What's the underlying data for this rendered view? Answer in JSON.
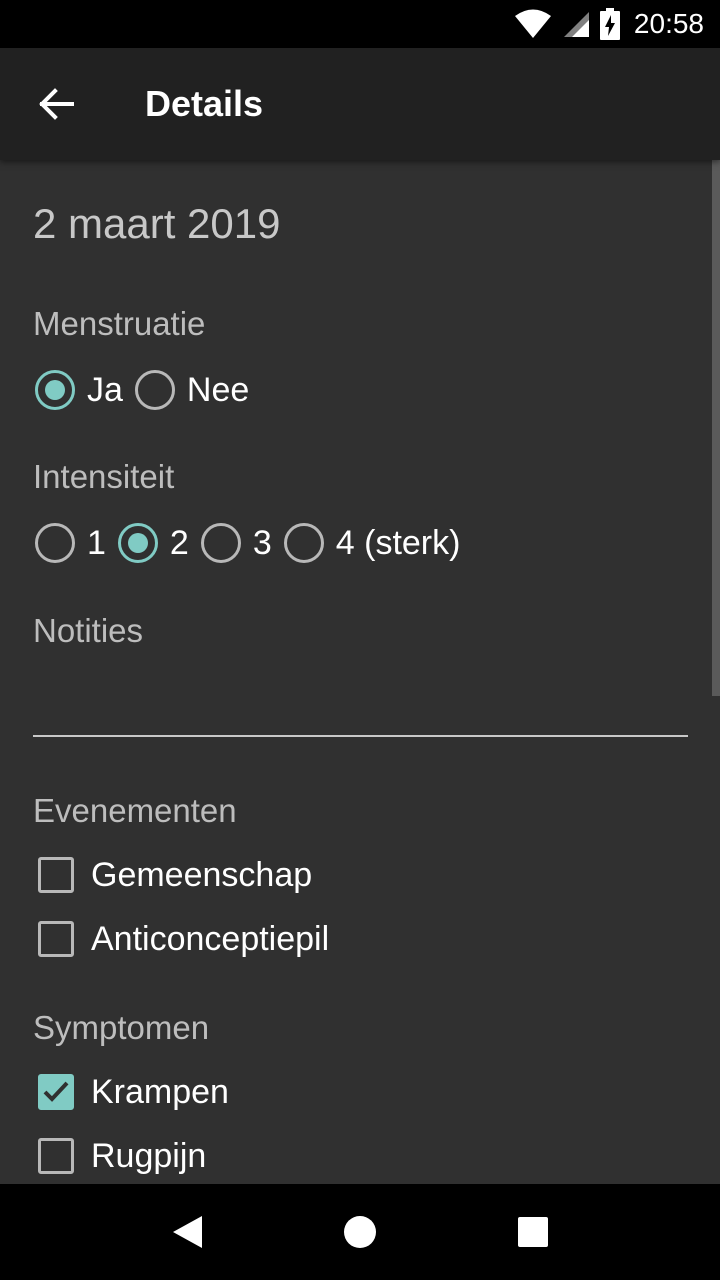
{
  "status_bar": {
    "time": "20:58"
  },
  "app_bar": {
    "title": "Details"
  },
  "date": "2 maart 2019",
  "menstruatie": {
    "label": "Menstruatie",
    "options": [
      {
        "label": "Ja",
        "selected": true
      },
      {
        "label": "Nee",
        "selected": false
      }
    ]
  },
  "intensiteit": {
    "label": "Intensiteit",
    "options": [
      {
        "label": "1",
        "selected": false
      },
      {
        "label": "2",
        "selected": true
      },
      {
        "label": "3",
        "selected": false
      },
      {
        "label": "4 (sterk)",
        "selected": false
      }
    ]
  },
  "notities": {
    "label": "Notities",
    "value": ""
  },
  "evenementen": {
    "label": "Evenementen",
    "items": [
      {
        "label": "Gemeenschap",
        "checked": false
      },
      {
        "label": "Anticonceptiepil",
        "checked": false
      }
    ]
  },
  "symptomen": {
    "label": "Symptomen",
    "items": [
      {
        "label": "Krampen",
        "checked": true
      },
      {
        "label": "Rugpijn",
        "checked": false
      }
    ]
  },
  "colors": {
    "accent": "#80cbc4",
    "background": "#303030",
    "app_bar": "#212121"
  },
  "icons": {
    "back": "arrow-left-icon",
    "wifi": "wifi-icon",
    "signal": "signal-icon",
    "battery": "battery-charging-icon",
    "nav_back": "triangle-back-icon",
    "nav_home": "circle-home-icon",
    "nav_recents": "square-recents-icon"
  }
}
